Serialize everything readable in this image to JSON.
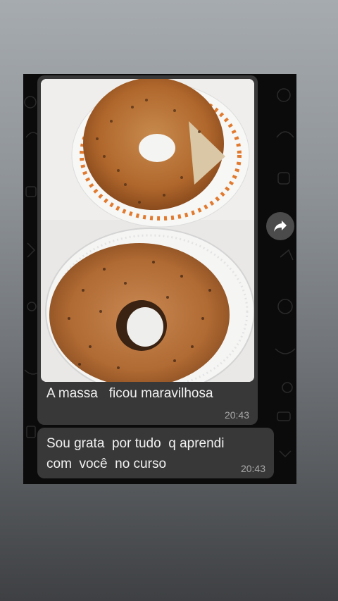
{
  "messages": [
    {
      "type": "image",
      "image_alt": "Two baked ring cakes on white plates",
      "caption": "A massa   ficou maravilhosa",
      "time": "20:43"
    },
    {
      "type": "text",
      "lines": [
        "Sou grata  por tudo  q aprendi",
        "com  você  no curso"
      ],
      "time": "20:43"
    }
  ],
  "icons": {
    "forward": "forward-share-icon"
  },
  "colors": {
    "bubble": "#383838",
    "chat_background": "#0b0b0b",
    "timestamp": "#a8a8a8"
  }
}
